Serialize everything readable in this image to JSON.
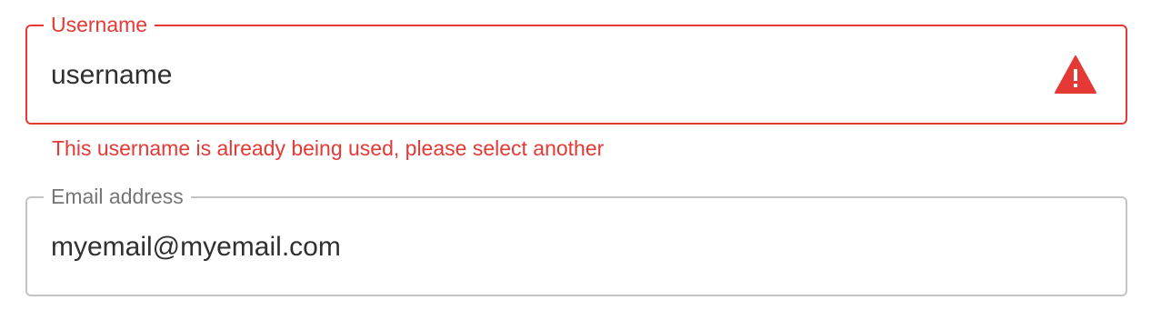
{
  "username_field": {
    "label": "Username",
    "value": "username",
    "error_text": "This username is already being used, please select another",
    "icon": "warning-triangle-icon",
    "state": "error",
    "error_color": "#e53935"
  },
  "email_field": {
    "label": "Email address",
    "value": "myemail@myemail.com",
    "border_color": "#c4c4c4"
  },
  "link": {
    "text": "",
    "color": "#1976d2"
  }
}
